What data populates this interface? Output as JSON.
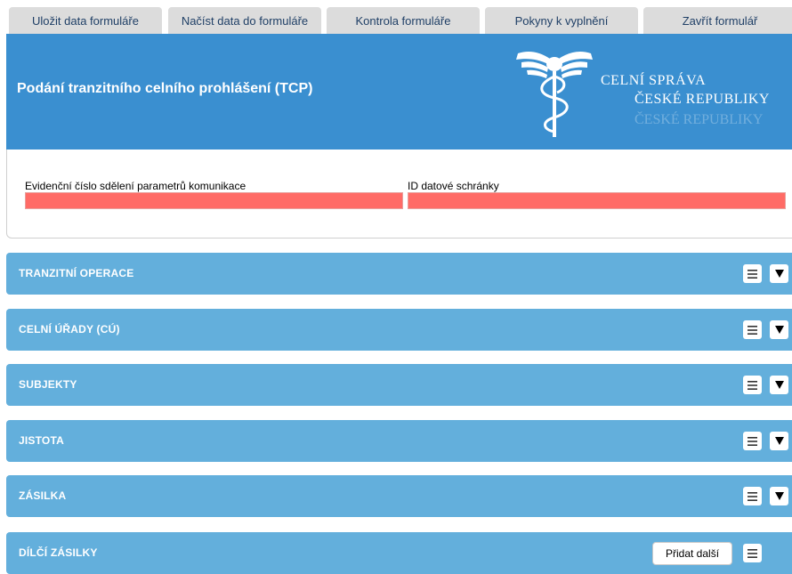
{
  "tabs": [
    {
      "label": "Uložit data formuláře"
    },
    {
      "label": "Načíst data do formuláře"
    },
    {
      "label": "Kontrola formuláře"
    },
    {
      "label": "Pokyny k vyplnění"
    },
    {
      "label": "Zavřít formulář"
    }
  ],
  "header": {
    "title": "Podání tranzitního celního prohlášení (TCP)",
    "logo_line1": "Celní správa",
    "logo_line2": "České republiky",
    "background_color": "#3a8fd0"
  },
  "form": {
    "evidencni_label": "Evidenční číslo sdělení parametrů komunikace",
    "evidencni_value": "",
    "datova_label": "ID datové schránky",
    "datova_value": "",
    "invalid_color": "#ff6b66"
  },
  "sections": [
    {
      "title": "TRANZITNÍ OPERACE",
      "menu_icon": "hamburger-icon",
      "toggle_icon": "triangle-down-icon"
    },
    {
      "title": "CELNÍ ÚŘADY (CÚ)",
      "menu_icon": "hamburger-icon",
      "toggle_icon": "triangle-down-icon"
    },
    {
      "title": "SUBJEKTY",
      "menu_icon": "hamburger-icon",
      "toggle_icon": "triangle-down-icon"
    },
    {
      "title": "JISTOTA",
      "menu_icon": "hamburger-icon",
      "toggle_icon": "triangle-down-icon"
    },
    {
      "title": "ZÁSILKA",
      "menu_icon": "hamburger-icon",
      "toggle_icon": "triangle-down-icon"
    },
    {
      "title": "DÍLČÍ ZÁSILKY",
      "add_label": "Přidat další",
      "menu_icon": "hamburger-icon"
    }
  ],
  "colors": {
    "section_bg": "#63afdc",
    "tab_bg": "#dcdcdc",
    "tab_text": "#1f3f66"
  }
}
